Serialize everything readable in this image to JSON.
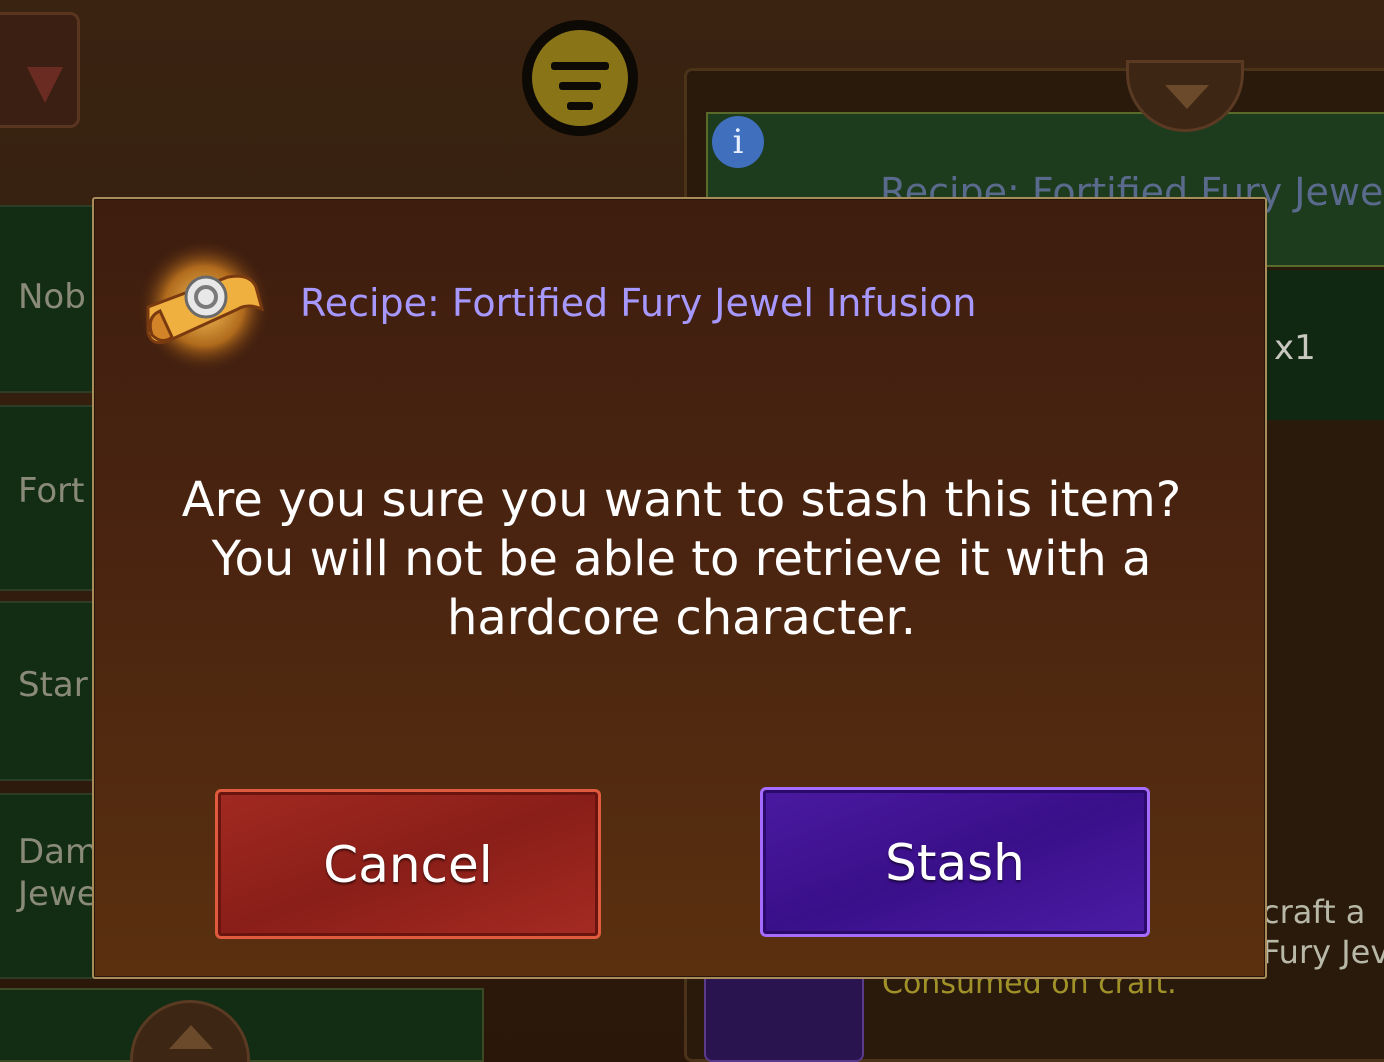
{
  "background": {
    "left_list": {
      "items": [
        {
          "label": "Nob"
        },
        {
          "label": "Fort"
        },
        {
          "label": "Star"
        },
        {
          "label_line1": "Dam",
          "label_line2": "Jewe"
        }
      ]
    },
    "right_panel": {
      "header_title": "Recipe: Fortified Fury Jewel",
      "info_glyph": "i",
      "quantity": "x1",
      "description_line1": "craft a",
      "description_line2": "Fury Jev",
      "consumed_text": "Consumed on craft."
    }
  },
  "dialog": {
    "title": "Recipe: Fortified Fury Jewel Infusion",
    "message": "Are you sure you want to stash this item? You will not be able to retrieve it with a hardcore character.",
    "cancel_label": "Cancel",
    "stash_label": "Stash"
  },
  "colors": {
    "title_color": "#a698ff",
    "cancel_button": "#9a2620",
    "stash_button": "#42138f",
    "modal_bg": "#4a2410"
  },
  "icons": {
    "dropdown": "triangle-down-icon",
    "filter": "filter-icon",
    "recipe": "recipe-scroll-icon",
    "info": "info-icon",
    "scroll_down": "chevron-down-icon",
    "scroll_up": "chevron-up-icon"
  }
}
